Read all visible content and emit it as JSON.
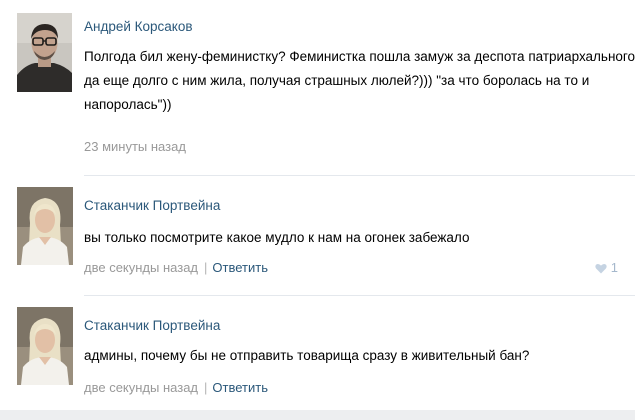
{
  "comments": [
    {
      "author": "Андрей Корсаков",
      "text_lines": [
        "Полгода бил жену-феминистку? Феминистка пошла замуж за деспота патриархального типа",
        "да еще долго с ним жила, получая страшных люлей?))) \"за что боролась на то и",
        "напоролась\"))"
      ],
      "time": "23 минуты назад",
      "avatar_icon": "male-avatar-photo"
    },
    {
      "author": "Стаканчик Портвейна",
      "text_lines": [
        "вы только посмотрите какое мудло к нам на огонек забежало"
      ],
      "time": "две секунды назад",
      "separator": "|",
      "reply_label": "Ответить",
      "like_count": "1",
      "like_icon": "heart-icon",
      "avatar_icon": "female-avatar-photo"
    },
    {
      "author": "Стаканчик Портвейна",
      "text_lines": [
        "админы, почему бы не отправить товарища сразу в живительный бан?"
      ],
      "time": "две секунды назад",
      "separator": "|",
      "reply_label": "Ответить",
      "avatar_icon": "female-avatar-photo"
    }
  ],
  "colors": {
    "link": "#2b587a",
    "meta": "#999999",
    "divider": "#e4e8ed",
    "like": "#a5b8cc"
  }
}
